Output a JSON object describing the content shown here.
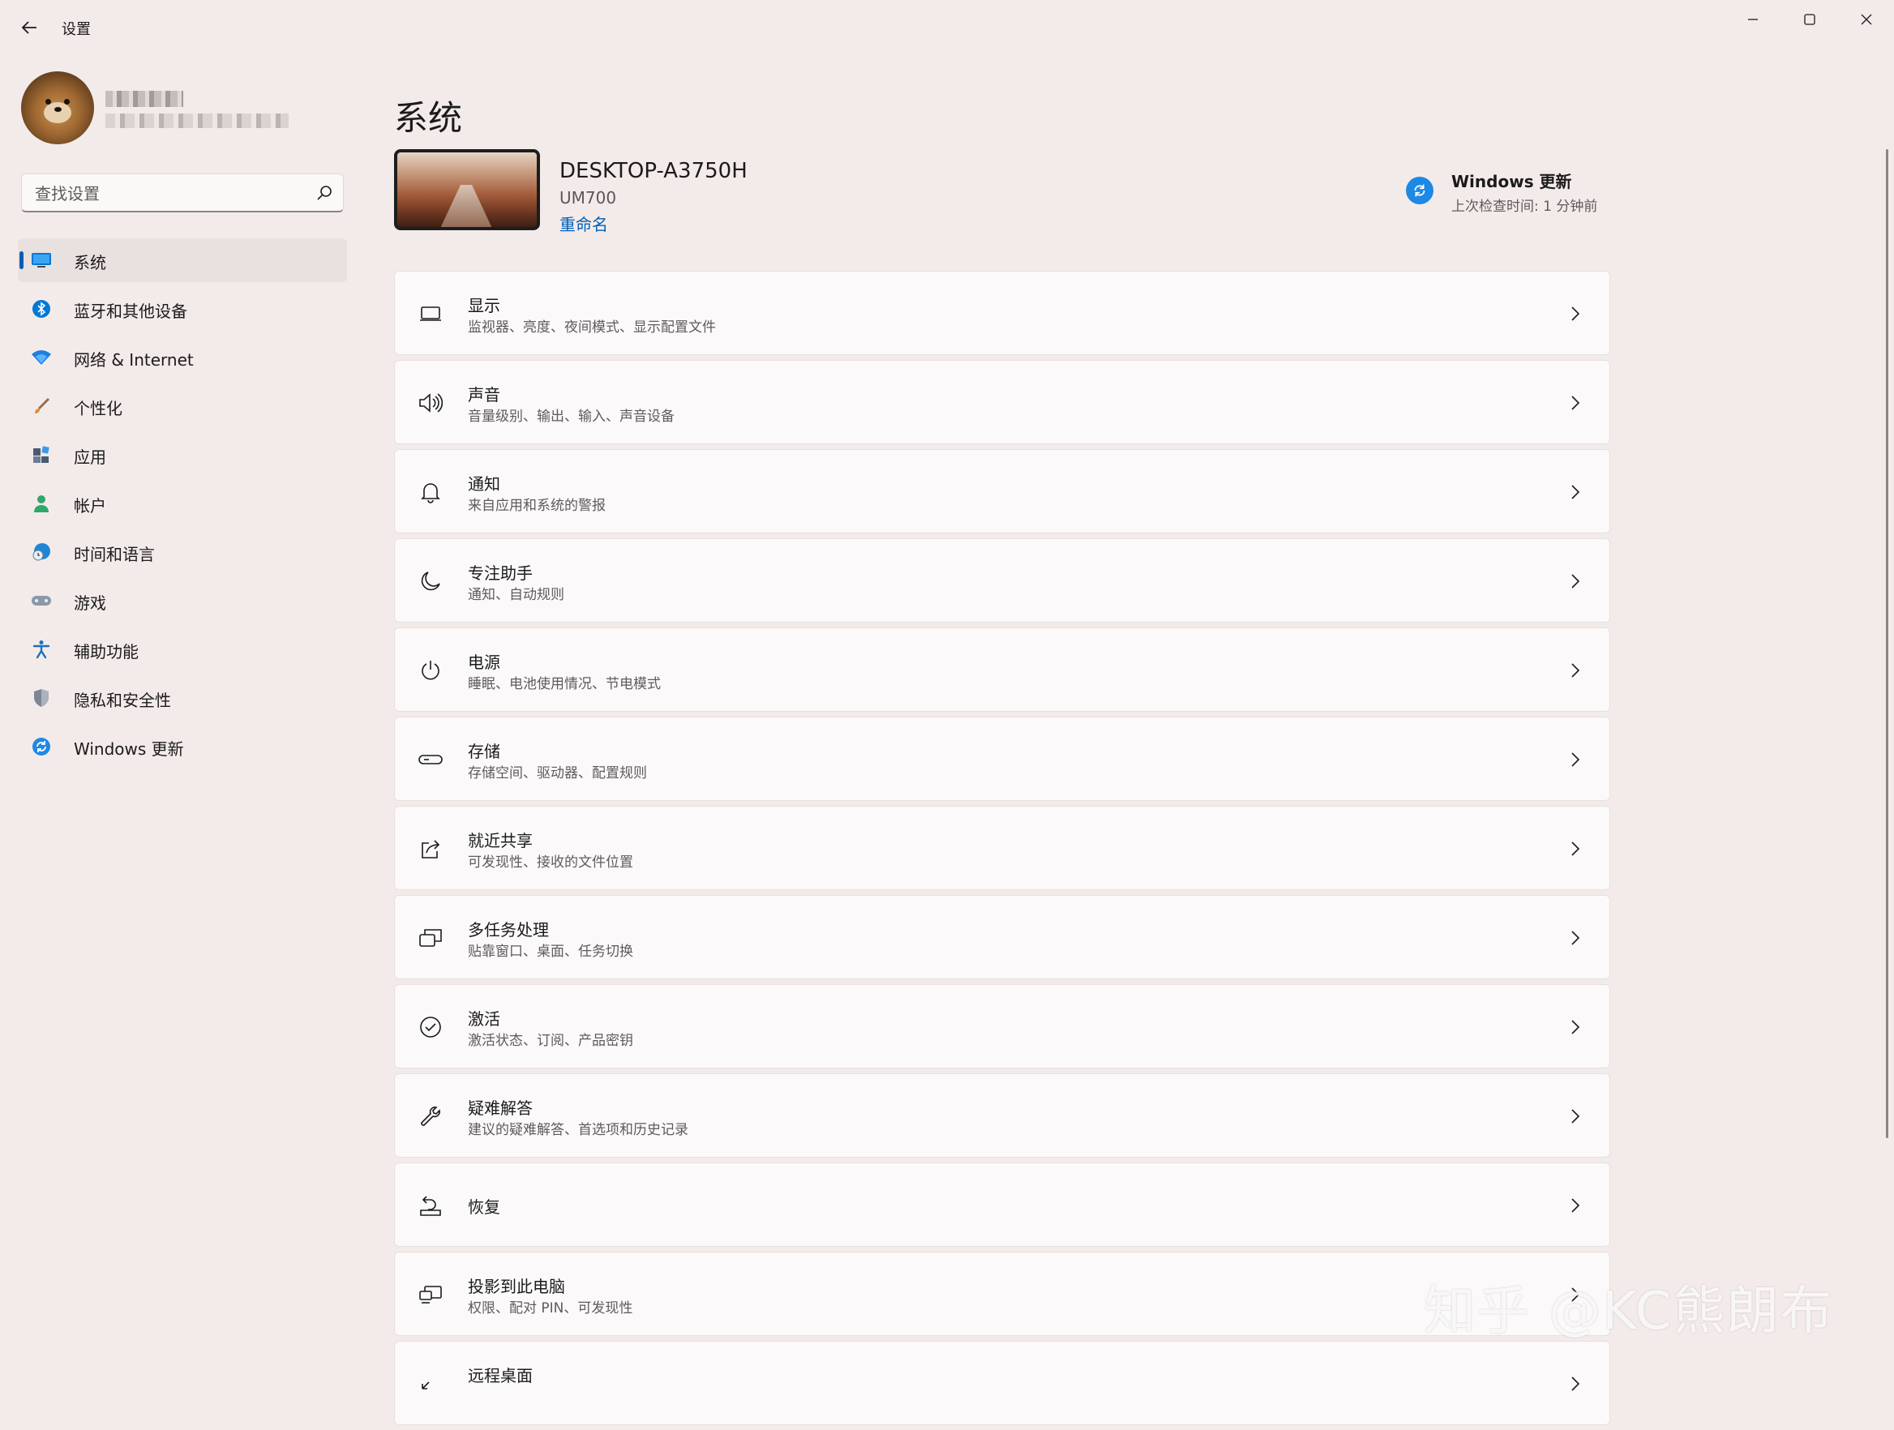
{
  "window": {
    "title": "设置",
    "minimize_icon": "minimize-icon",
    "maximize_icon": "maximize-icon",
    "close_icon": "close-icon"
  },
  "search": {
    "placeholder": "查找设置"
  },
  "sidebar": {
    "items": [
      {
        "label": "系统",
        "icon": "system-monitor-icon",
        "active": true,
        "color": "#0078d4"
      },
      {
        "label": "蓝牙和其他设备",
        "icon": "bluetooth-icon",
        "color": "#0078d4"
      },
      {
        "label": "网络 & Internet",
        "icon": "wifi-icon",
        "color": "#1f7fdd"
      },
      {
        "label": "个性化",
        "icon": "brush-icon",
        "color": "#e08a3c"
      },
      {
        "label": "应用",
        "icon": "apps-icon",
        "color": "#4a5a72"
      },
      {
        "label": "帐户",
        "icon": "account-icon",
        "color": "#2fa86b"
      },
      {
        "label": "时间和语言",
        "icon": "globe-clock-icon",
        "color": "#1f86d6"
      },
      {
        "label": "游戏",
        "icon": "gamepad-icon",
        "color": "#8b98a8"
      },
      {
        "label": "辅助功能",
        "icon": "accessibility-icon",
        "color": "#1d6fc1"
      },
      {
        "label": "隐私和安全性",
        "icon": "shield-icon",
        "color": "#7d8794"
      },
      {
        "label": "Windows 更新",
        "icon": "windows-update-icon",
        "color": "#1e88e5"
      }
    ]
  },
  "main": {
    "title": "系统",
    "device": {
      "name": "DESKTOP-A3750H",
      "model": "UM700",
      "rename_label": "重命名"
    },
    "update": {
      "title": "Windows 更新",
      "subtitle": "上次检查时间: 1 分钟前"
    },
    "cards": [
      {
        "title": "显示",
        "subtitle": "监视器、亮度、夜间模式、显示配置文件",
        "icon": "display-icon"
      },
      {
        "title": "声音",
        "subtitle": "音量级别、输出、输入、声音设备",
        "icon": "speaker-icon"
      },
      {
        "title": "通知",
        "subtitle": "来自应用和系统的警报",
        "icon": "bell-icon"
      },
      {
        "title": "专注助手",
        "subtitle": "通知、自动规则",
        "icon": "moon-icon"
      },
      {
        "title": "电源",
        "subtitle": "睡眠、电池使用情况、节电模式",
        "icon": "power-icon"
      },
      {
        "title": "存储",
        "subtitle": "存储空间、驱动器、配置规则",
        "icon": "storage-icon"
      },
      {
        "title": "就近共享",
        "subtitle": "可发现性、接收的文件位置",
        "icon": "share-icon"
      },
      {
        "title": "多任务处理",
        "subtitle": "贴靠窗口、桌面、任务切换",
        "icon": "multitask-icon"
      },
      {
        "title": "激活",
        "subtitle": "激活状态、订阅、产品密钥",
        "icon": "check-circle-icon"
      },
      {
        "title": "疑难解答",
        "subtitle": "建议的疑难解答、首选项和历史记录",
        "icon": "wrench-icon"
      },
      {
        "title": "恢复",
        "subtitle": "",
        "icon": "recovery-icon"
      },
      {
        "title": "投影到此电脑",
        "subtitle": "权限、配对 PIN、可发现性",
        "icon": "project-icon"
      },
      {
        "title": "远程桌面",
        "subtitle": "",
        "icon": "remote-desktop-icon"
      }
    ]
  },
  "watermark": "知乎 @KC熊朗布",
  "colors": {
    "accent": "#005fb8",
    "background": "#f3ebea",
    "card": "#fbf9f9"
  }
}
